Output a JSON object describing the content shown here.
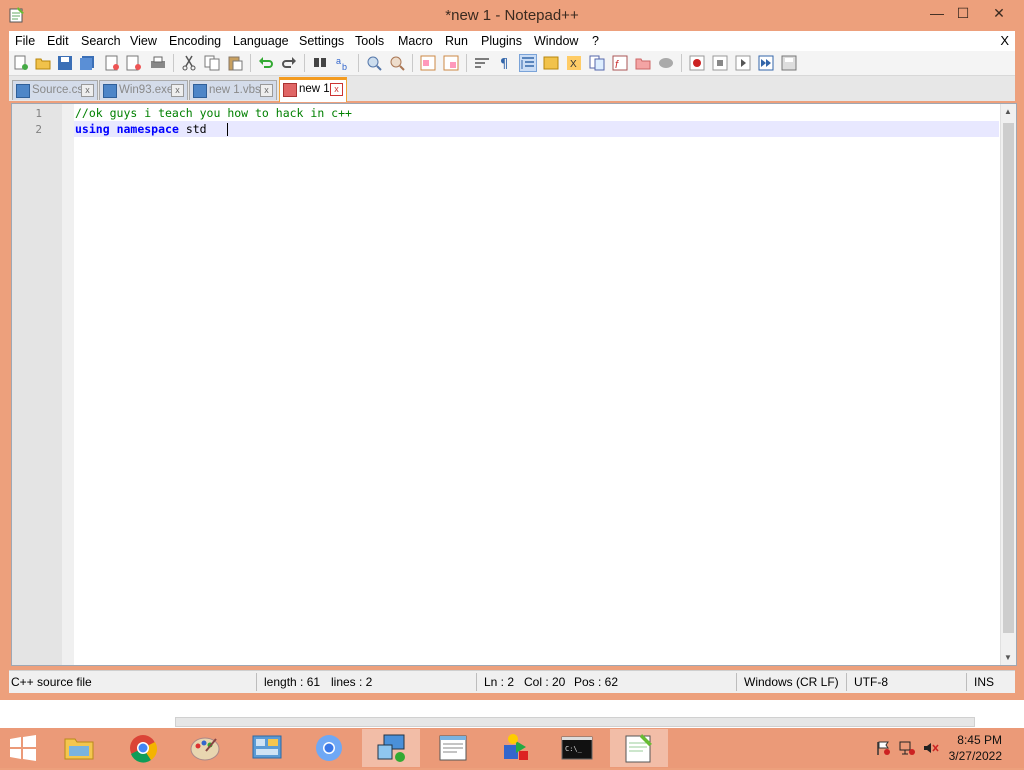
{
  "window": {
    "title": "*new 1 - Notepad++",
    "minimize": "—",
    "maximize": "☐",
    "close": "✕"
  },
  "menu": {
    "items": [
      "File",
      "Edit",
      "Search",
      "View",
      "Encoding",
      "Language",
      "Settings",
      "Tools",
      "Macro",
      "Run",
      "Plugins",
      "Window",
      "?"
    ],
    "close_doc": "X"
  },
  "tabs": [
    {
      "label": "Source.cs",
      "close": "x"
    },
    {
      "label": "Win93.exe",
      "close": "x"
    },
    {
      "label": "new 1.vbs",
      "close": "x"
    },
    {
      "label": "new 1",
      "close": "x"
    }
  ],
  "editor": {
    "line_numbers": [
      "1",
      "2"
    ],
    "line1_text": "//ok guys i teach you how to hack in c++",
    "line2_kw1": "using",
    "line2_kw2": "namespace",
    "line2_rest": "std",
    "colors": {
      "comment": "#008000",
      "keyword": "#0000ff",
      "current_line": "#e8e8ff"
    }
  },
  "statusbar": {
    "filetype": "C++ source file",
    "length": "length : 61",
    "lines": "lines : 2",
    "ln": "Ln : 2",
    "col": "Col : 20",
    "pos": "Pos : 62",
    "eol": "Windows (CR LF)",
    "encoding": "UTF-8",
    "mode": "INS"
  },
  "taskbar": {
    "apps": [
      "file-explorer-icon",
      "chrome-icon",
      "paint-icon",
      "control-panel-icon",
      "chromium-icon",
      "network-icon",
      "notepad-icon",
      "3d-app-icon",
      "cmd-icon",
      "notepadpp-icon"
    ],
    "clock_time": "8:45 PM",
    "clock_date": "3/27/2022"
  }
}
